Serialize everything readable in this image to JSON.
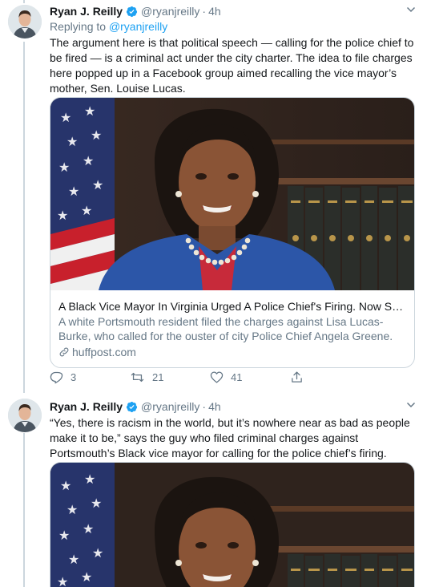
{
  "tweets": [
    {
      "name": "Ryan J. Reilly",
      "handle": "@ryanjreilly",
      "dot": "·",
      "time": "4h",
      "reply_prefix": "Replying to",
      "reply_to": "@ryanjreilly",
      "text": "The argument here is that political speech — calling for the police chief to be fired — is a criminal act under the city charter. The idea to file charges here popped up in a Facebook group aimed recalling the vice mayor’s mother, Sen. Louise Lucas.",
      "card": {
        "title": "A Black Vice Mayor In Virginia Urged A Police Chief's Firing. Now She Fa...",
        "description": "A white Portsmouth resident filed the charges against Lisa Lucas-Burke, who called for the ouster of city Police Chief Angela Greene.",
        "domain": "huffpost.com"
      },
      "actions": {
        "replies": "3",
        "retweets": "21",
        "likes": "41"
      }
    },
    {
      "name": "Ryan J. Reilly",
      "handle": "@ryanjreilly",
      "dot": "·",
      "time": "4h",
      "text": "“Yes, there is racism in the world, but it’s nowhere near as bad as people make it to be,” says the guy who filed criminal charges against Portsmouth’s Black vice mayor for calling for the police chief’s firing."
    }
  ],
  "colors": {
    "accent": "#1da1f2",
    "secondary_text": "#657786",
    "border": "#ccd6dd"
  },
  "icons": [
    "verified-badge-icon",
    "chevron-down-icon",
    "reply-icon",
    "retweet-icon",
    "like-icon",
    "share-icon",
    "link-icon"
  ]
}
